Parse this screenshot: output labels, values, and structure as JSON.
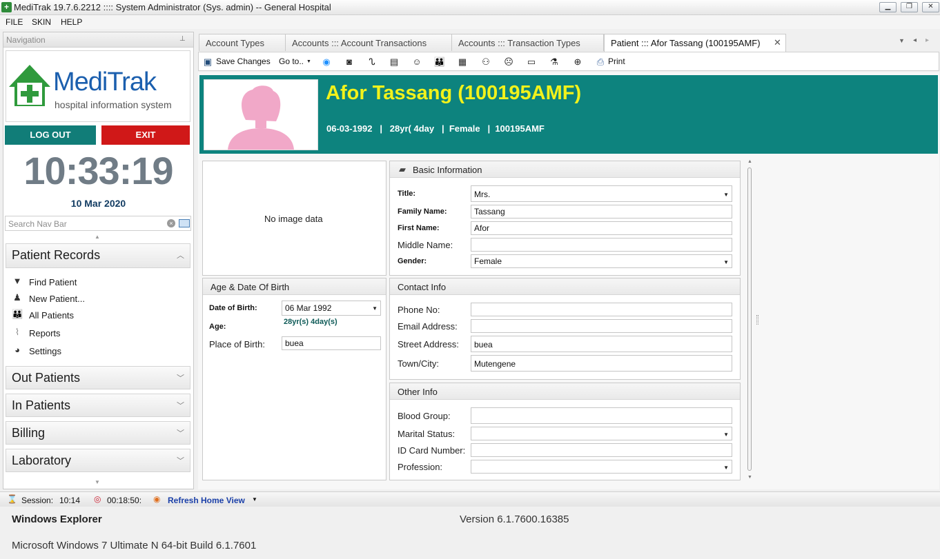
{
  "window": {
    "title": "MediTrak 19.7.6.2212 :::: System Administrator (Sys. admin) -- General Hospital",
    "min": "▁",
    "max": "❐",
    "close": "✕"
  },
  "menu": [
    "FILE",
    "SKIN",
    "HELP"
  ],
  "nav": {
    "header": "Navigation",
    "pin": "⊥",
    "logo_name": "MediTrak",
    "logo_tagline": "hospital information system",
    "logout_label": "LOG OUT",
    "exit_label": "EXIT",
    "clock": "10:33:19",
    "date": "10 Mar 2020",
    "search_placeholder": "Search Nav Bar",
    "groups": {
      "patient_records": "Patient Records",
      "out_patients": "Out Patients",
      "in_patients": "In Patients",
      "billing": "Billing",
      "laboratory": "Laboratory"
    },
    "items": [
      {
        "label": "Find Patient",
        "icon": "funnel-icon"
      },
      {
        "label": "New Patient...",
        "icon": "user-add-icon"
      },
      {
        "label": "All Patients",
        "icon": "users-icon"
      },
      {
        "label": "Reports",
        "icon": "chart-icon"
      },
      {
        "label": "Settings",
        "icon": "gauge-icon"
      }
    ]
  },
  "tabs": [
    {
      "label": "Account Types"
    },
    {
      "label": "Accounts ::: Account Transactions"
    },
    {
      "label": "Accounts ::: Transaction Types"
    },
    {
      "label": "Patient ::: Afor Tassang (100195AMF)"
    }
  ],
  "toolbar": {
    "save": "Save Changes",
    "goto": "Go to..",
    "print": "Print"
  },
  "patient": {
    "name": "Afor Tassang (100195AMF)",
    "summary": "06-03-1992   |   28yr( 4day   |  Female   |  100195AMF"
  },
  "image_panel": {
    "text": "No image data"
  },
  "age_panel": {
    "title": "Age & Date Of Birth",
    "dob_label": "Date of Birth:",
    "dob_value": "06 Mar 1992",
    "age_label": "Age:",
    "age_value": "28yr(s) 4day(s)",
    "pob_label": "Place of Birth:",
    "pob_value": "buea"
  },
  "basic": {
    "title": "Basic Information",
    "title_label": "Title:",
    "title_value": "Mrs.",
    "family_label": "Family Name:",
    "family_value": "Tassang",
    "first_label": "First Name:",
    "first_value": "Afor",
    "middle_label": "Middle Name:",
    "middle_value": "",
    "gender_label": "Gender:",
    "gender_value": "Female"
  },
  "contact": {
    "title": "Contact Info",
    "phone_label": "Phone No:",
    "phone_value": "",
    "email_label": "Email Address:",
    "email_value": "",
    "street_label": "Street Address:",
    "street_value": "buea",
    "town_label": "Town/City:",
    "town_value": "Mutengene"
  },
  "other": {
    "title": "Other Info",
    "blood_label": "Blood Group:",
    "blood_value": "",
    "marital_label": "Marital Status:",
    "marital_value": "",
    "idcard_label": "ID Card Number:",
    "idcard_value": "",
    "profession_label": "Profession:",
    "profession_value": ""
  },
  "status": {
    "session_label": "Session:",
    "session_value": "10:14",
    "timer": "00:18:50:",
    "refresh": "Refresh Home View"
  },
  "sysinfo": {
    "app": "Windows Explorer",
    "version": "Version 6.1.7600.16385",
    "os": "Microsoft Windows 7 Ultimate N  64-bit Build 6.1.7601"
  },
  "colors": {
    "teal": "#0d837e",
    "exit_red": "#d01818",
    "name_yellow": "#f2f21b"
  }
}
